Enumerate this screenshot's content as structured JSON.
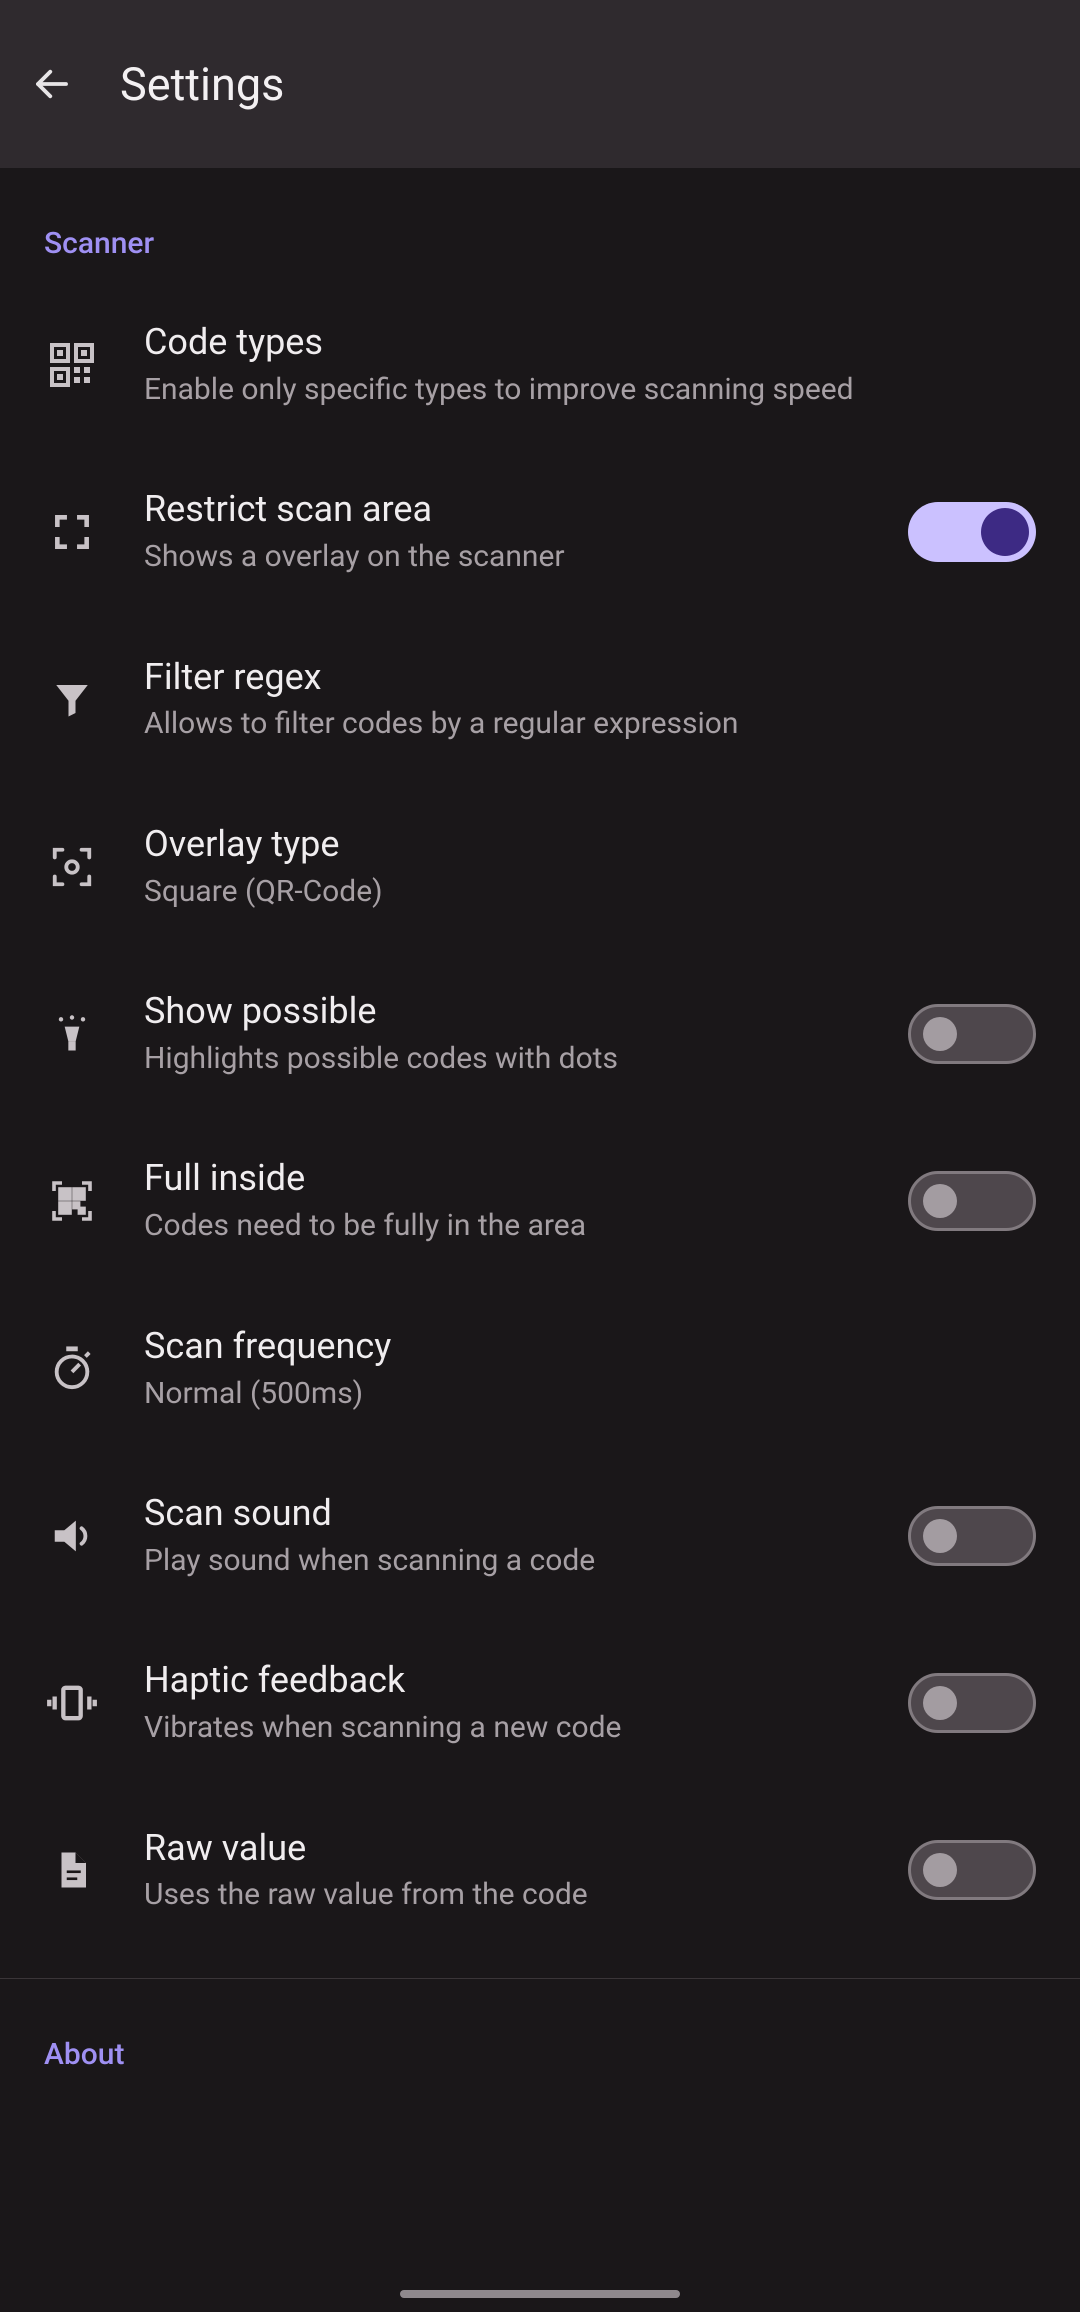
{
  "header": {
    "title": "Settings"
  },
  "sections": {
    "scanner": {
      "label": "Scanner",
      "items": {
        "code_types": {
          "title": "Code types",
          "subtitle": "Enable only specific types to improve scanning speed"
        },
        "restrict_scan_area": {
          "title": "Restrict scan area",
          "subtitle": "Shows a overlay on the scanner",
          "checked": true
        },
        "filter_regex": {
          "title": "Filter regex",
          "subtitle": "Allows to filter codes by a regular expression"
        },
        "overlay_type": {
          "title": "Overlay type",
          "subtitle": "Square (QR-Code)"
        },
        "show_possible": {
          "title": "Show possible",
          "subtitle": "Highlights possible codes with dots",
          "checked": false
        },
        "full_inside": {
          "title": "Full inside",
          "subtitle": "Codes need to be fully in the area",
          "checked": false
        },
        "scan_frequency": {
          "title": "Scan frequency",
          "subtitle": "Normal (500ms)"
        },
        "scan_sound": {
          "title": "Scan sound",
          "subtitle": "Play sound when scanning a code",
          "checked": false
        },
        "haptic_feedback": {
          "title": "Haptic feedback",
          "subtitle": "Vibrates when scanning a new code",
          "checked": false
        },
        "raw_value": {
          "title": "Raw value",
          "subtitle": "Uses the raw value from the code",
          "checked": false
        }
      }
    },
    "about": {
      "label": "About"
    }
  }
}
